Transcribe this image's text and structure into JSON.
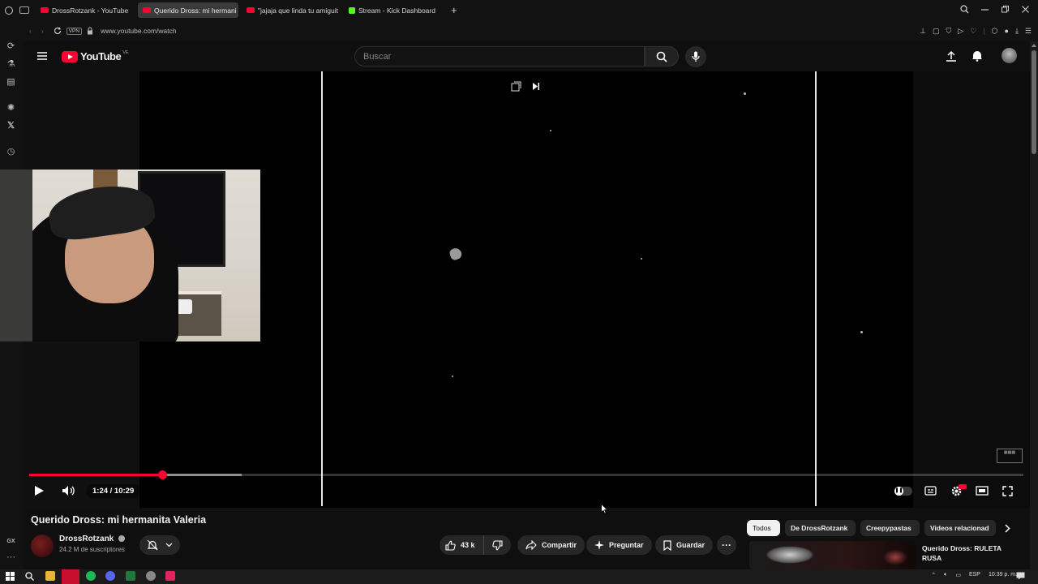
{
  "browser": {
    "tabs": [
      {
        "label": "DrossRotzank - YouTube",
        "active": false,
        "favicon": "youtube-favicon"
      },
      {
        "label": "Querido Dross: mi hermani",
        "active": true,
        "favicon": "youtube-favicon"
      },
      {
        "label": "\"jajaja que linda tu amiguit",
        "active": false,
        "favicon": "youtube-favicon"
      },
      {
        "label": "Stream - Kick Dashboard",
        "active": false,
        "favicon": "kick-favicon"
      }
    ],
    "vpn_label": "VPN",
    "url": "www.youtube.com/watch",
    "sidebar_bottom_label": "GX"
  },
  "youtube": {
    "logo_text": "YouTube",
    "region": "VE",
    "search_placeholder": "Buscar"
  },
  "player": {
    "time_display": "1:24 / 10:29",
    "current_seconds": 84,
    "duration_seconds": 629,
    "buffered_fraction": 0.214
  },
  "video": {
    "title": "Querido Dross: mi hermanita Valeria",
    "channel": "DrossRotzank",
    "subscribers": "24.2 M de suscriptores",
    "likes": "43 k",
    "share_label": "Compartir",
    "ask_label": "Preguntar",
    "save_label": "Guardar"
  },
  "chips": [
    "Todos",
    "De DrossRotzank",
    "Creepypastas",
    "Videos relacionad"
  ],
  "recommendation": {
    "title": "Querido Dross: RULETA RUSA"
  },
  "taskbar": {
    "language": "ESP",
    "clock": "10:39 p. m."
  },
  "colors": {
    "accent": "#ff0033",
    "background": "#0f0f0f",
    "pill": "#272727",
    "kick": "#53fc18"
  }
}
